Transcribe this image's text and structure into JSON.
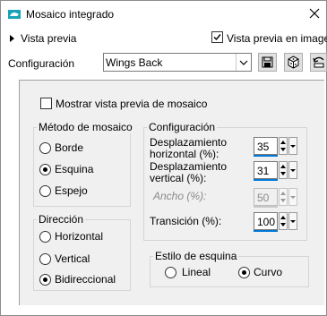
{
  "window": {
    "title": "Mosaico integrado"
  },
  "preview": {
    "expander_label": "Vista previa",
    "checkbox_label": "Vista previa en imagen",
    "checked": true
  },
  "config_bar": {
    "label": "Configuración",
    "preset_value": "Wings Back",
    "icons": [
      "save-icon",
      "randomize-icon",
      "reset-icon"
    ]
  },
  "tile_preview": {
    "label": "Mostrar vista previa de mosaico",
    "checked": false
  },
  "tiling_method": {
    "title": "Método de mosaico",
    "options": [
      {
        "label": "Borde",
        "selected": false
      },
      {
        "label": "Esquina",
        "selected": true
      },
      {
        "label": "Espejo",
        "selected": false
      }
    ]
  },
  "direction": {
    "title": "Dirección",
    "options": [
      {
        "label": "Horizontal",
        "selected": false
      },
      {
        "label": "Vertical",
        "selected": false
      },
      {
        "label": "Bidireccional",
        "selected": true
      }
    ]
  },
  "settings": {
    "title": "Configuración",
    "h_offset_label_1": "Desplazamiento",
    "h_offset_label_2": "horizontal (%):",
    "h_offset_value": "35",
    "v_offset_label_1": "Desplazamiento",
    "v_offset_label_2": "vertical (%):",
    "v_offset_value": "31",
    "width_label": "Ancho (%):",
    "width_value": "50",
    "transition_label": "Transición (%):",
    "transition_value": "100"
  },
  "corner_style": {
    "title": "Estilo de esquina",
    "options": [
      {
        "label": "Lineal",
        "selected": false
      },
      {
        "label": "Curvo",
        "selected": true
      }
    ]
  },
  "colors": {
    "accent": "#0078d7",
    "panel_bg": "#f0f0f0",
    "icon_teal": "#1aa3b8"
  }
}
